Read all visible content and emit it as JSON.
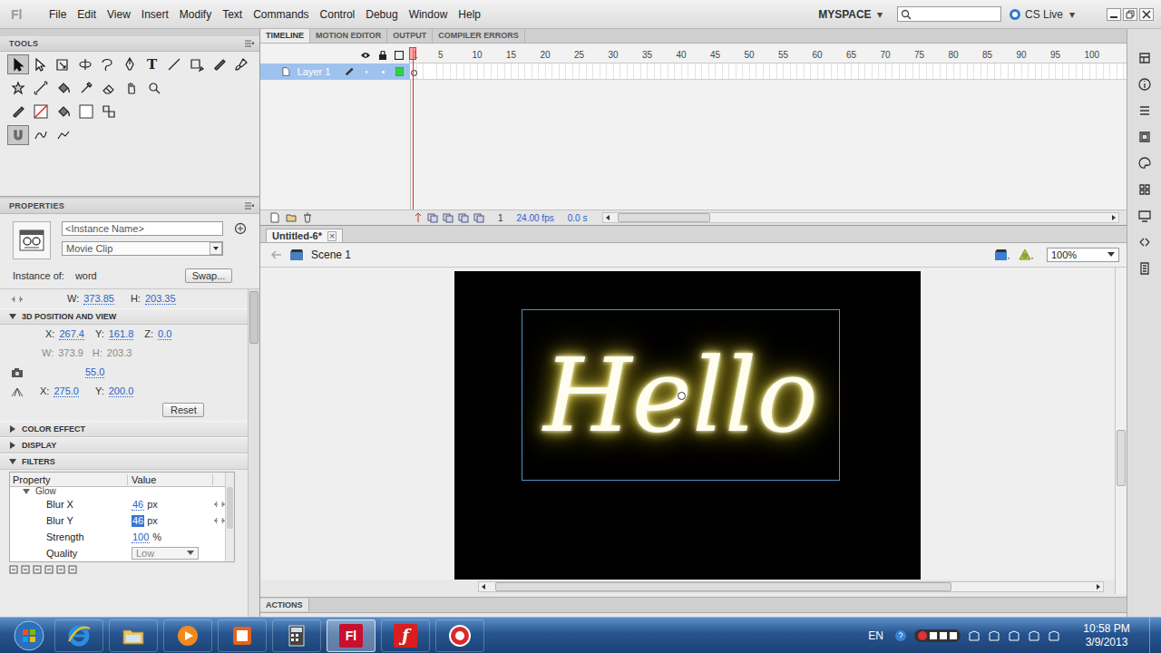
{
  "menu_bar": {
    "logo": "Fl",
    "items": [
      "File",
      "Edit",
      "View",
      "Insert",
      "Modify",
      "Text",
      "Commands",
      "Control",
      "Debug",
      "Window",
      "Help"
    ],
    "workspace": "MYSPACE",
    "workspace_arrow": "▾",
    "cs_live": "CS Live",
    "cs_live_arrow": "▾"
  },
  "tools": {
    "title": "TOOLS",
    "rows": [
      [
        {
          "kind": "arrow",
          "selected": true
        },
        {
          "kind": "subselect",
          "selected": false
        },
        {
          "kind": "transform",
          "selected": false
        },
        {
          "kind": "rotate3d",
          "selected": false
        },
        {
          "kind": "lasso",
          "selected": false
        },
        {
          "kind": "pen",
          "selected": false
        },
        {
          "kind": "text",
          "glyph": "T",
          "selected": false
        },
        {
          "kind": "line",
          "selected": false
        },
        {
          "kind": "oval",
          "selected": false
        },
        {
          "kind": "pencil",
          "selected": false
        },
        {
          "kind": "brush",
          "selected": false
        }
      ],
      [
        {
          "kind": "deco",
          "selected": false
        },
        {
          "kind": "bone",
          "selected": false
        },
        {
          "kind": "bucket",
          "selected": false
        },
        {
          "kind": "eyedropper",
          "selected": false
        },
        {
          "kind": "eraser",
          "selected": false
        },
        {
          "kind": "hand",
          "selected": false
        },
        {
          "kind": "zoom",
          "selected": false
        }
      ],
      [
        {
          "kind": "stroke-pencil",
          "selected": false
        },
        {
          "kind": "stroke-swatch",
          "selected": false
        },
        {
          "kind": "fill-bucket",
          "selected": false
        },
        {
          "kind": "fill-swatch",
          "selected": false
        },
        {
          "kind": "swap",
          "selected": false
        }
      ],
      [
        {
          "kind": "snap",
          "selected": true
        },
        {
          "kind": "smooth",
          "selected": false
        },
        {
          "kind": "straighten",
          "selected": false
        }
      ]
    ]
  },
  "properties": {
    "title": "PROPERTIES",
    "instance_name": {
      "placeholder": "<Instance Name>"
    },
    "symbol_type": "Movie Clip",
    "instance_of_label": "Instance of:",
    "instance_of": "word",
    "swap_button": "Swap...",
    "size": [
      {
        "label": "W:",
        "value": "373.85",
        "disabled": false
      },
      {
        "label": "H:",
        "value": "203.35",
        "disabled": false
      }
    ],
    "position_3d": {
      "title": "3D POSITION AND VIEW",
      "expanded": true,
      "position": [
        {
          "label": "X:",
          "value": "267.4"
        },
        {
          "label": "Y:",
          "value": "161.8"
        },
        {
          "label": "Z:",
          "value": "0.0"
        }
      ],
      "size": [
        {
          "label": "W:",
          "value": "373.9",
          "disabled": true
        },
        {
          "label": "H:",
          "value": "203.3",
          "disabled": true
        }
      ],
      "perspective": "55.0",
      "vanishing_point": [
        {
          "label": "X:",
          "value": "275.0"
        },
        {
          "label": "Y:",
          "value": "200.0"
        }
      ],
      "reset_button": "Reset"
    },
    "collapsed_sections": [
      {
        "title": "COLOR EFFECT",
        "expanded": false
      },
      {
        "title": "DISPLAY",
        "expanded": false
      }
    ],
    "filters": {
      "title": "FILTERS",
      "expanded": true,
      "columns": [
        "Property",
        "Value"
      ],
      "filter_name": "Glow",
      "filter_expanded": true,
      "rows": [
        {
          "property": "Blur X",
          "value": "46",
          "unit": "px",
          "kind": "number",
          "selected": false,
          "linked": true
        },
        {
          "property": "Blur Y",
          "value": "46",
          "unit": "px",
          "kind": "number",
          "selected": true,
          "linked": true
        },
        {
          "property": "Strength",
          "value": "100",
          "unit": "%",
          "kind": "number",
          "selected": false,
          "linked": false
        },
        {
          "property": "Quality",
          "value": "Low",
          "unit": "",
          "kind": "dropdown",
          "selected": false,
          "linked": false
        }
      ]
    }
  },
  "timeline": {
    "tabs": [
      {
        "label": "TIMELINE",
        "selected": true
      },
      {
        "label": "MOTION EDITOR",
        "selected": false
      },
      {
        "label": "OUTPUT",
        "selected": false
      },
      {
        "label": "COMPILER ERRORS",
        "selected": false
      }
    ],
    "layers": [
      {
        "name": "Layer 1",
        "selected": true
      }
    ],
    "frame_numbers": [
      "1",
      "5",
      "10",
      "15",
      "20",
      "25",
      "30",
      "35",
      "40",
      "45",
      "50",
      "55",
      "60",
      "65",
      "70",
      "75",
      "80",
      "85",
      "90",
      "95",
      "100"
    ],
    "current_frame": "1",
    "fps": "24.00 fps",
    "elapsed": "0.0 s"
  },
  "document": {
    "tabs": [
      {
        "label": "Untitled-6*",
        "selected": true
      }
    ],
    "close_glyph": "×",
    "scene": "Scene 1",
    "zoom": "100%",
    "stage": {
      "text": "Hello",
      "selected": true
    }
  },
  "actions": {
    "title": "ACTIONS"
  },
  "taskbar": {
    "apps": [
      {
        "kind": "ie",
        "label": "",
        "active": false
      },
      {
        "kind": "explorer",
        "label": "",
        "active": false
      },
      {
        "kind": "media",
        "label": "",
        "active": false
      },
      {
        "kind": "office",
        "label": "",
        "active": false
      },
      {
        "kind": "calc",
        "label": "",
        "active": false
      },
      {
        "kind": "flash-pro",
        "label": "Fl",
        "active": true
      },
      {
        "kind": "flash-player",
        "label": "ƒ",
        "active": false
      },
      {
        "kind": "recorder",
        "label": "",
        "active": false
      }
    ],
    "language": "EN",
    "time": "10:58 PM",
    "date": "3/9/2013"
  }
}
